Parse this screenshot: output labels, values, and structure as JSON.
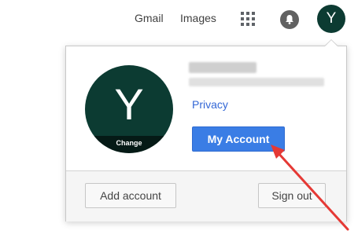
{
  "topbar": {
    "gmail": "Gmail",
    "images": "Images",
    "apps_icon": "apps-grid-icon",
    "notifications_icon": "bell-icon",
    "avatar_letter": "Y"
  },
  "account_popup": {
    "avatar_letter": "Y",
    "change_label": "Change",
    "privacy_link": "Privacy",
    "my_account_button": "My Account",
    "add_account_button": "Add account",
    "sign_out_button": "Sign out"
  },
  "colors": {
    "avatar_bg": "#0c3b32",
    "primary_button": "#3a7de5",
    "link": "#3367d6",
    "annotation_arrow": "#e53935"
  }
}
